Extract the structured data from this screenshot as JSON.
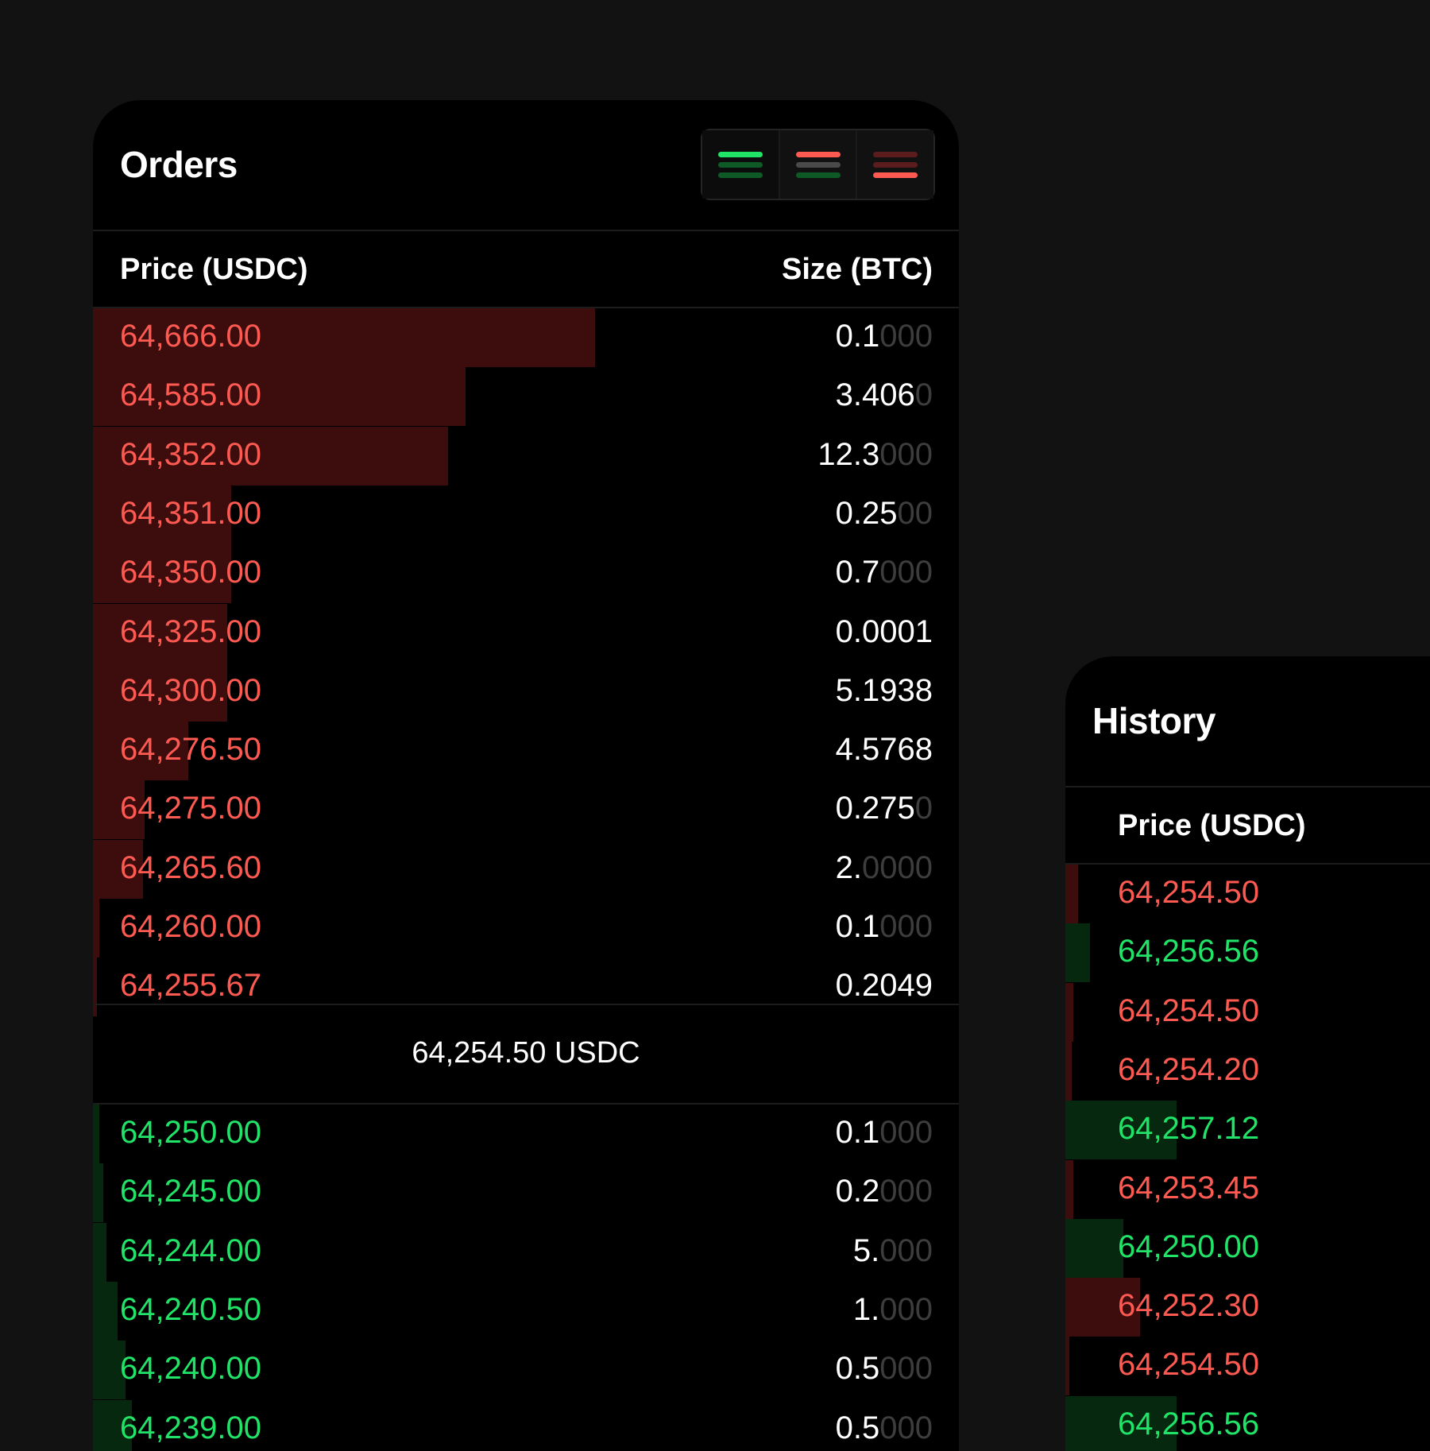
{
  "orders": {
    "title": "Orders",
    "view_modes": [
      "both-sides-view",
      "asks-bids-view",
      "asks-view"
    ],
    "headers": {
      "price": "Price (USDC)",
      "size": "Size (BTC)"
    },
    "asks": [
      {
        "price": "64,666.00",
        "size_main": "0.1",
        "size_fade": "000",
        "depth": 0.58
      },
      {
        "price": "64,585.00",
        "size_main": "3.406",
        "size_fade": "0",
        "depth": 0.43
      },
      {
        "price": "64,352.00",
        "size_main": "12.3",
        "size_fade": "000",
        "depth": 0.41
      },
      {
        "price": "64,351.00",
        "size_main": "0.25",
        "size_fade": "00",
        "depth": 0.16
      },
      {
        "price": "64,350.00",
        "size_main": "0.7",
        "size_fade": "000",
        "depth": 0.16
      },
      {
        "price": "64,325.00",
        "size_main": "0.0001",
        "size_fade": "",
        "depth": 0.155
      },
      {
        "price": "64,300.00",
        "size_main": "5.1938",
        "size_fade": "",
        "depth": 0.155
      },
      {
        "price": "64,276.50",
        "size_main": "4.5768",
        "size_fade": "",
        "depth": 0.11
      },
      {
        "price": "64,275.00",
        "size_main": "0.275",
        "size_fade": "0",
        "depth": 0.06
      },
      {
        "price": "64,265.60",
        "size_main": "2.",
        "size_fade": "0000",
        "depth": 0.058
      },
      {
        "price": "64,260.00",
        "size_main": "0.1",
        "size_fade": "000",
        "depth": 0.007
      },
      {
        "price": "64,255.67",
        "size_main": "0.2049",
        "size_fade": "",
        "depth": 0.005
      }
    ],
    "mid_price": "64,254.50 USDC",
    "bids": [
      {
        "price": "64,250.00",
        "size_main": "0.1",
        "size_fade": "000",
        "depth": 0.007
      },
      {
        "price": "64,245.00",
        "size_main": "0.2",
        "size_fade": "000",
        "depth": 0.012
      },
      {
        "price": "64,244.00",
        "size_main": "5.",
        "size_fade": "000",
        "depth": 0.016
      },
      {
        "price": "64,240.50",
        "size_main": "1.",
        "size_fade": "000",
        "depth": 0.028
      },
      {
        "price": "64,240.00",
        "size_main": "0.5",
        "size_fade": "000",
        "depth": 0.038
      },
      {
        "price": "64,239.00",
        "size_main": "0.5",
        "size_fade": "000",
        "depth": 0.045
      }
    ]
  },
  "history": {
    "title": "History",
    "headers": {
      "price": "Price (USDC)"
    },
    "trades": [
      {
        "price": "64,254.50",
        "side": "sell",
        "depth": 0.03
      },
      {
        "price": "64,256.56",
        "side": "buy",
        "depth": 0.06
      },
      {
        "price": "64,254.50",
        "side": "sell",
        "depth": 0.02
      },
      {
        "price": "64,254.20",
        "side": "sell",
        "depth": 0.015
      },
      {
        "price": "64,257.12",
        "side": "buy",
        "depth": 0.27
      },
      {
        "price": "64,253.45",
        "side": "sell",
        "depth": 0.02
      },
      {
        "price": "64,250.00",
        "side": "buy",
        "depth": 0.14
      },
      {
        "price": "64,252.30",
        "side": "sell",
        "depth": 0.18
      },
      {
        "price": "64,254.50",
        "side": "sell",
        "depth": 0.01
      },
      {
        "price": "64,256.56",
        "side": "buy",
        "depth": 0.27
      }
    ]
  },
  "colors": {
    "ask": "#ff5a52",
    "bid": "#20e467",
    "ask_depth": "#3d0d0d",
    "bid_depth": "#06280f",
    "background": "#121212",
    "panel": "#000000"
  }
}
